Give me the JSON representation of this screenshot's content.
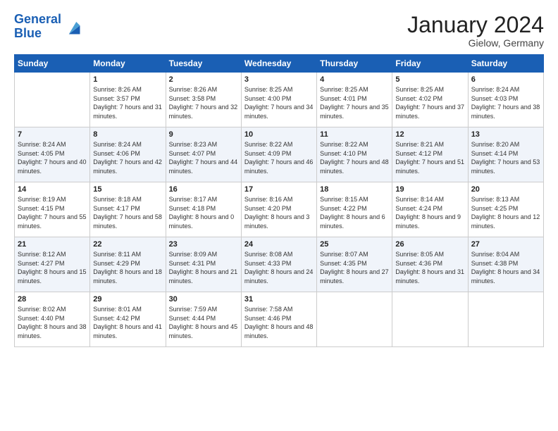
{
  "logo": {
    "line1": "General",
    "line2": "Blue"
  },
  "title": "January 2024",
  "location": "Gielow, Germany",
  "days_of_week": [
    "Sunday",
    "Monday",
    "Tuesday",
    "Wednesday",
    "Thursday",
    "Friday",
    "Saturday"
  ],
  "weeks": [
    [
      {
        "day": "",
        "sunrise": "",
        "sunset": "",
        "daylight": ""
      },
      {
        "day": "1",
        "sunrise": "Sunrise: 8:26 AM",
        "sunset": "Sunset: 3:57 PM",
        "daylight": "Daylight: 7 hours and 31 minutes."
      },
      {
        "day": "2",
        "sunrise": "Sunrise: 8:26 AM",
        "sunset": "Sunset: 3:58 PM",
        "daylight": "Daylight: 7 hours and 32 minutes."
      },
      {
        "day": "3",
        "sunrise": "Sunrise: 8:25 AM",
        "sunset": "Sunset: 4:00 PM",
        "daylight": "Daylight: 7 hours and 34 minutes."
      },
      {
        "day": "4",
        "sunrise": "Sunrise: 8:25 AM",
        "sunset": "Sunset: 4:01 PM",
        "daylight": "Daylight: 7 hours and 35 minutes."
      },
      {
        "day": "5",
        "sunrise": "Sunrise: 8:25 AM",
        "sunset": "Sunset: 4:02 PM",
        "daylight": "Daylight: 7 hours and 37 minutes."
      },
      {
        "day": "6",
        "sunrise": "Sunrise: 8:24 AM",
        "sunset": "Sunset: 4:03 PM",
        "daylight": "Daylight: 7 hours and 38 minutes."
      }
    ],
    [
      {
        "day": "7",
        "sunrise": "Sunrise: 8:24 AM",
        "sunset": "Sunset: 4:05 PM",
        "daylight": "Daylight: 7 hours and 40 minutes."
      },
      {
        "day": "8",
        "sunrise": "Sunrise: 8:24 AM",
        "sunset": "Sunset: 4:06 PM",
        "daylight": "Daylight: 7 hours and 42 minutes."
      },
      {
        "day": "9",
        "sunrise": "Sunrise: 8:23 AM",
        "sunset": "Sunset: 4:07 PM",
        "daylight": "Daylight: 7 hours and 44 minutes."
      },
      {
        "day": "10",
        "sunrise": "Sunrise: 8:22 AM",
        "sunset": "Sunset: 4:09 PM",
        "daylight": "Daylight: 7 hours and 46 minutes."
      },
      {
        "day": "11",
        "sunrise": "Sunrise: 8:22 AM",
        "sunset": "Sunset: 4:10 PM",
        "daylight": "Daylight: 7 hours and 48 minutes."
      },
      {
        "day": "12",
        "sunrise": "Sunrise: 8:21 AM",
        "sunset": "Sunset: 4:12 PM",
        "daylight": "Daylight: 7 hours and 51 minutes."
      },
      {
        "day": "13",
        "sunrise": "Sunrise: 8:20 AM",
        "sunset": "Sunset: 4:14 PM",
        "daylight": "Daylight: 7 hours and 53 minutes."
      }
    ],
    [
      {
        "day": "14",
        "sunrise": "Sunrise: 8:19 AM",
        "sunset": "Sunset: 4:15 PM",
        "daylight": "Daylight: 7 hours and 55 minutes."
      },
      {
        "day": "15",
        "sunrise": "Sunrise: 8:18 AM",
        "sunset": "Sunset: 4:17 PM",
        "daylight": "Daylight: 7 hours and 58 minutes."
      },
      {
        "day": "16",
        "sunrise": "Sunrise: 8:17 AM",
        "sunset": "Sunset: 4:18 PM",
        "daylight": "Daylight: 8 hours and 0 minutes."
      },
      {
        "day": "17",
        "sunrise": "Sunrise: 8:16 AM",
        "sunset": "Sunset: 4:20 PM",
        "daylight": "Daylight: 8 hours and 3 minutes."
      },
      {
        "day": "18",
        "sunrise": "Sunrise: 8:15 AM",
        "sunset": "Sunset: 4:22 PM",
        "daylight": "Daylight: 8 hours and 6 minutes."
      },
      {
        "day": "19",
        "sunrise": "Sunrise: 8:14 AM",
        "sunset": "Sunset: 4:24 PM",
        "daylight": "Daylight: 8 hours and 9 minutes."
      },
      {
        "day": "20",
        "sunrise": "Sunrise: 8:13 AM",
        "sunset": "Sunset: 4:25 PM",
        "daylight": "Daylight: 8 hours and 12 minutes."
      }
    ],
    [
      {
        "day": "21",
        "sunrise": "Sunrise: 8:12 AM",
        "sunset": "Sunset: 4:27 PM",
        "daylight": "Daylight: 8 hours and 15 minutes."
      },
      {
        "day": "22",
        "sunrise": "Sunrise: 8:11 AM",
        "sunset": "Sunset: 4:29 PM",
        "daylight": "Daylight: 8 hours and 18 minutes."
      },
      {
        "day": "23",
        "sunrise": "Sunrise: 8:09 AM",
        "sunset": "Sunset: 4:31 PM",
        "daylight": "Daylight: 8 hours and 21 minutes."
      },
      {
        "day": "24",
        "sunrise": "Sunrise: 8:08 AM",
        "sunset": "Sunset: 4:33 PM",
        "daylight": "Daylight: 8 hours and 24 minutes."
      },
      {
        "day": "25",
        "sunrise": "Sunrise: 8:07 AM",
        "sunset": "Sunset: 4:35 PM",
        "daylight": "Daylight: 8 hours and 27 minutes."
      },
      {
        "day": "26",
        "sunrise": "Sunrise: 8:05 AM",
        "sunset": "Sunset: 4:36 PM",
        "daylight": "Daylight: 8 hours and 31 minutes."
      },
      {
        "day": "27",
        "sunrise": "Sunrise: 8:04 AM",
        "sunset": "Sunset: 4:38 PM",
        "daylight": "Daylight: 8 hours and 34 minutes."
      }
    ],
    [
      {
        "day": "28",
        "sunrise": "Sunrise: 8:02 AM",
        "sunset": "Sunset: 4:40 PM",
        "daylight": "Daylight: 8 hours and 38 minutes."
      },
      {
        "day": "29",
        "sunrise": "Sunrise: 8:01 AM",
        "sunset": "Sunset: 4:42 PM",
        "daylight": "Daylight: 8 hours and 41 minutes."
      },
      {
        "day": "30",
        "sunrise": "Sunrise: 7:59 AM",
        "sunset": "Sunset: 4:44 PM",
        "daylight": "Daylight: 8 hours and 45 minutes."
      },
      {
        "day": "31",
        "sunrise": "Sunrise: 7:58 AM",
        "sunset": "Sunset: 4:46 PM",
        "daylight": "Daylight: 8 hours and 48 minutes."
      },
      {
        "day": "",
        "sunrise": "",
        "sunset": "",
        "daylight": ""
      },
      {
        "day": "",
        "sunrise": "",
        "sunset": "",
        "daylight": ""
      },
      {
        "day": "",
        "sunrise": "",
        "sunset": "",
        "daylight": ""
      }
    ]
  ]
}
